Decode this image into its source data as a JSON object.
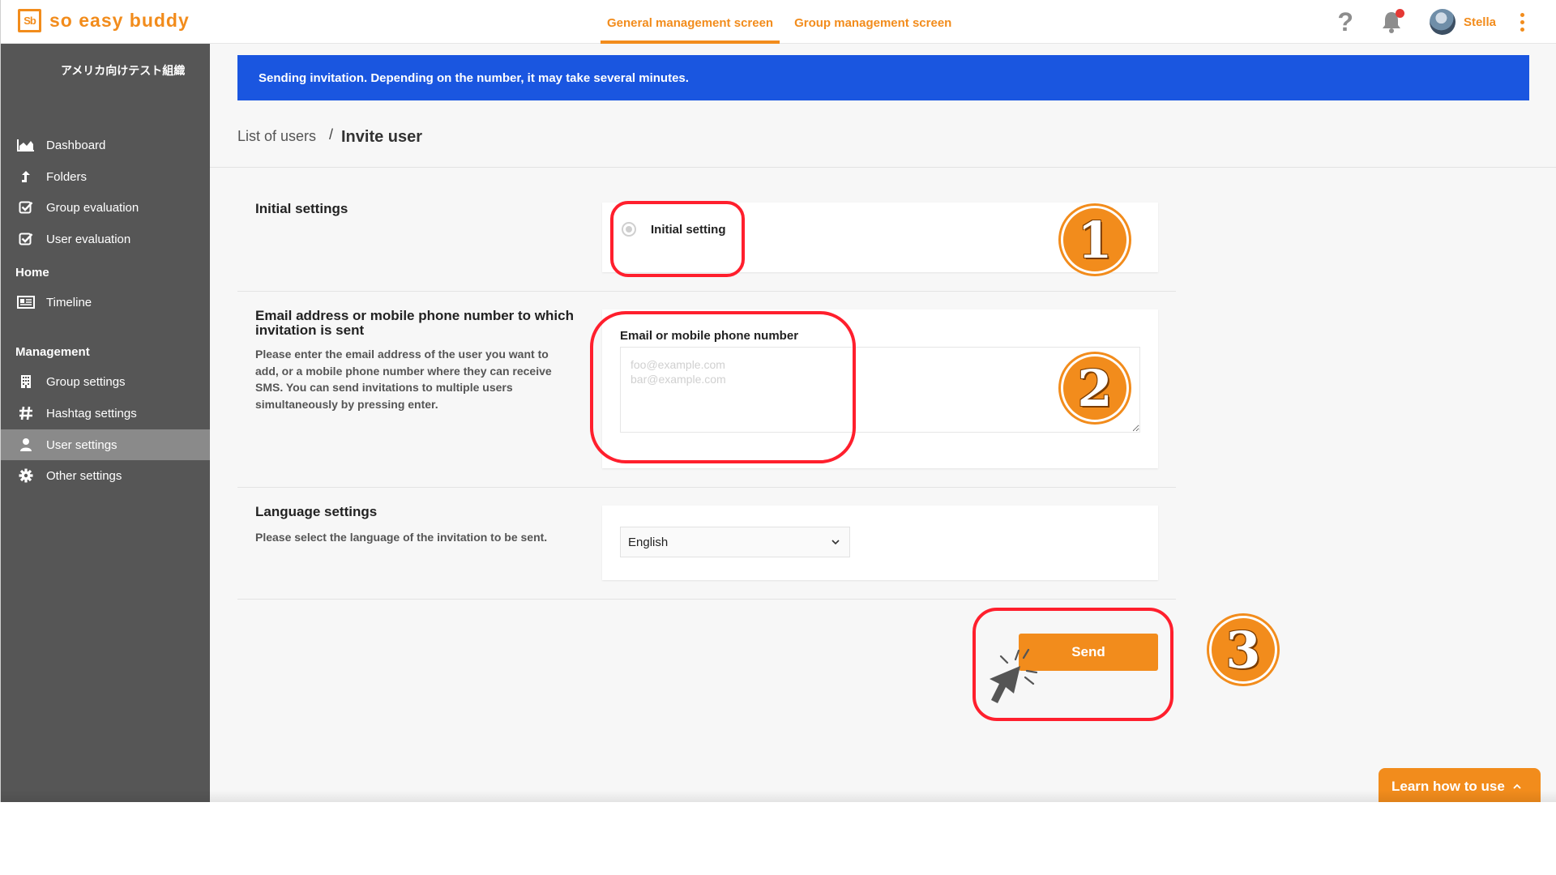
{
  "header": {
    "logo_mark": "Sb",
    "logo_text": "so easy buddy",
    "tabs": [
      {
        "label": "General management screen",
        "active": true
      },
      {
        "label": "Group management screen",
        "active": false
      }
    ],
    "help_icon": "?",
    "user_name": "Stella"
  },
  "sidebar": {
    "org_name": "アメリカ向けテスト組織",
    "top_items": [
      {
        "label": "Dashboard",
        "icon": "area-chart-icon"
      },
      {
        "label": "Folders",
        "icon": "upload-arrow-icon"
      },
      {
        "label": "Group evaluation",
        "icon": "check-square-icon"
      },
      {
        "label": "User evaluation",
        "icon": "check-square-icon"
      }
    ],
    "home_title": "Home",
    "home_items": [
      {
        "label": "Timeline",
        "icon": "newspaper-icon"
      }
    ],
    "management_title": "Management",
    "management_items": [
      {
        "label": "Group settings",
        "icon": "building-icon"
      },
      {
        "label": "Hashtag settings",
        "icon": "hashtag-icon"
      },
      {
        "label": "User settings",
        "icon": "user-icon",
        "active": true
      },
      {
        "label": "Other settings",
        "icon": "gear-icon"
      }
    ]
  },
  "banner": {
    "text": "Sending invitation. Depending on the number, it may take several minutes.",
    "color": "#1a56e0"
  },
  "breadcrumb": {
    "parent": "List of users",
    "separator": "/",
    "current": "Invite user"
  },
  "sections": {
    "initial": {
      "title": "Initial settings",
      "option_label": "Initial setting"
    },
    "email": {
      "title": "Email address or mobile phone number to which invitation is sent",
      "description": "Please enter the email address of the user you want to add, or a mobile phone number where they can receive SMS. You can send invitations to multiple users simultaneously by pressing enter.",
      "field_label": "Email or mobile phone number",
      "placeholder": "foo@example.com\nbar@example.com",
      "value": ""
    },
    "language": {
      "title": "Language settings",
      "description": "Please select the language of the invitation to be sent.",
      "selected": "English"
    }
  },
  "send_label": "Send",
  "learn_label": "Learn how to use",
  "annotations": {
    "badges": [
      "1",
      "2",
      "3"
    ],
    "highlight_color": "#ff1f2d",
    "badge_color": "#f28c1c"
  },
  "accent_color": "#f28c1c"
}
